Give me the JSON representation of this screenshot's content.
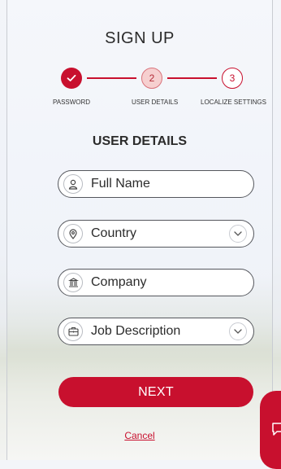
{
  "form": {
    "title": "SIGN UP",
    "subtitle": "USER DETAILS"
  },
  "steps": [
    {
      "number": "",
      "label": "PASSWORD",
      "state": "complete"
    },
    {
      "number": "2",
      "label": "USER DETAILS",
      "state": "current"
    },
    {
      "number": "3",
      "label": "LOCALIZE SETTINGS",
      "state": "upcoming"
    }
  ],
  "fields": {
    "full_name": {
      "placeholder": "Full Name",
      "icon": "person-icon"
    },
    "country": {
      "placeholder": "Country",
      "icon": "location-pin-icon"
    },
    "company": {
      "placeholder": "Company",
      "icon": "building-icon"
    },
    "job_description": {
      "placeholder": "Job Description",
      "icon": "briefcase-icon"
    }
  },
  "actions": {
    "next_label": "NEXT",
    "cancel_label": "Cancel"
  },
  "colors": {
    "accent": "#c8102e",
    "step_current_fill": "#f6cfcf",
    "text": "#2b2b2b"
  }
}
